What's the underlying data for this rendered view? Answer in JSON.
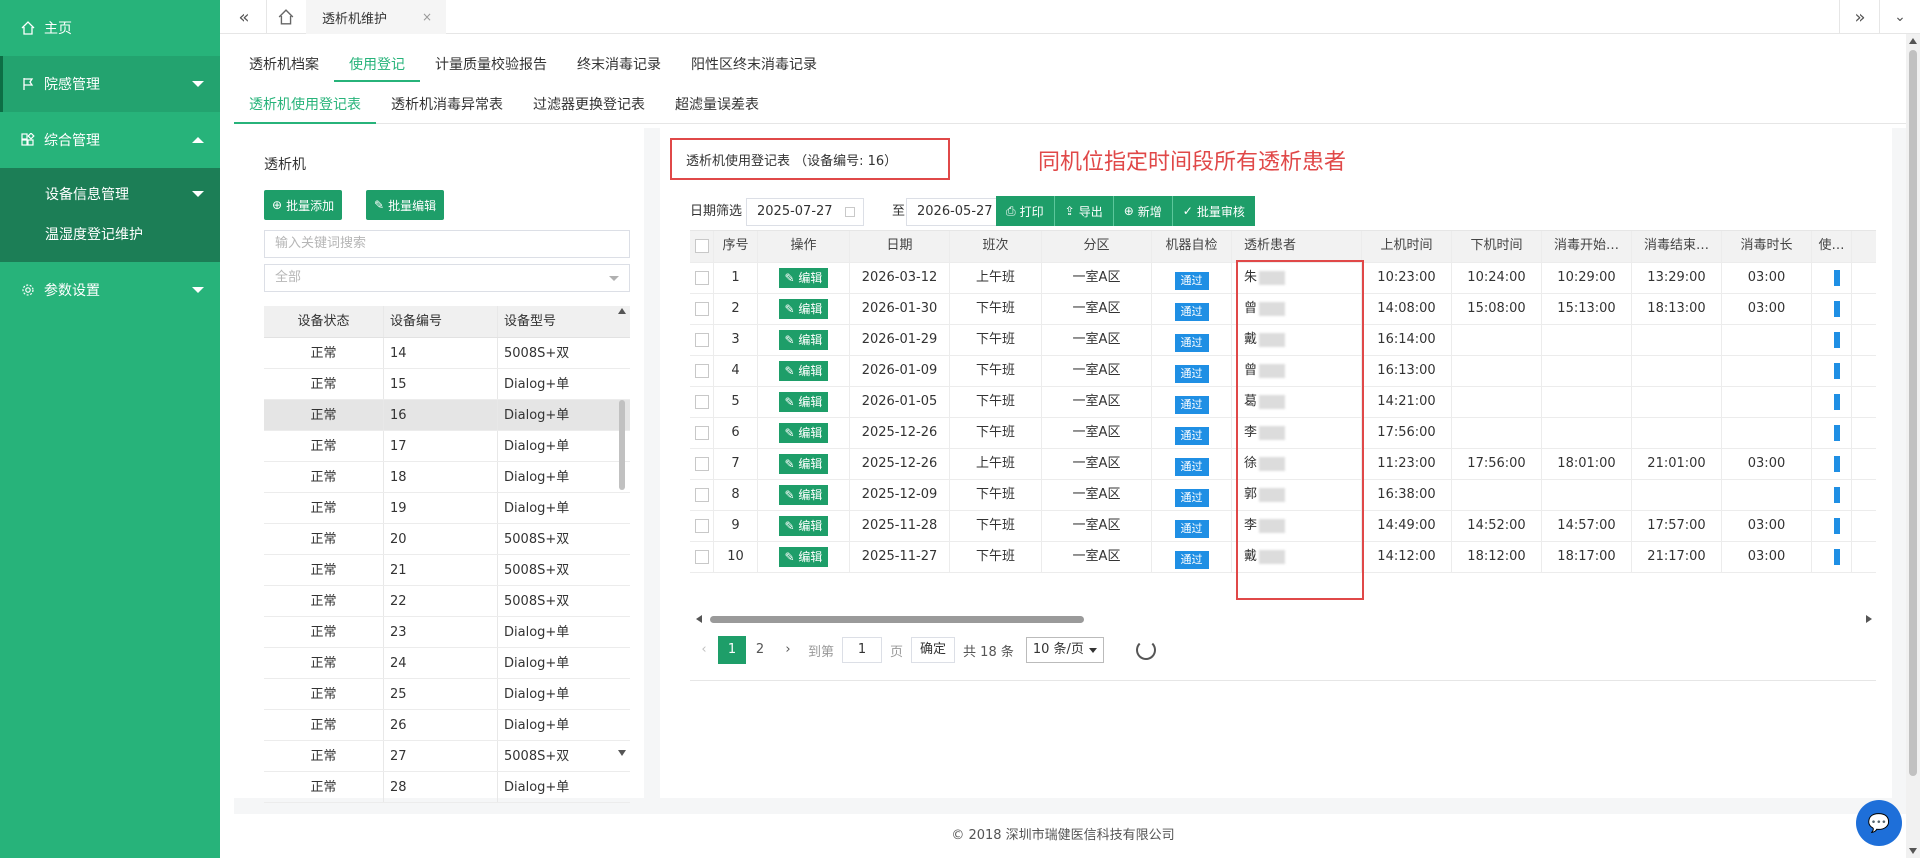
{
  "colors": {
    "sidebar": "#27b37a",
    "accent": "#1e9e69",
    "annotation": "#e04848",
    "badge": "#1f8fe4"
  },
  "sidebar": {
    "items": [
      {
        "label": "主页",
        "icon": "home-icon"
      },
      {
        "label": "院感管理",
        "icon": "flag-icon"
      },
      {
        "label": "综合管理",
        "icon": "apps-icon"
      },
      {
        "label": "参数设置",
        "icon": "gear-icon"
      }
    ],
    "sub_items": [
      {
        "label": "设备信息管理"
      },
      {
        "label": "温湿度登记维护"
      }
    ]
  },
  "topbar": {
    "current_tab": "透析机维护"
  },
  "tabs1": [
    "透析机档案",
    "使用登记",
    "计量质量校验报告",
    "终末消毒记录",
    "阳性区终末消毒记录"
  ],
  "tabs2": [
    "透析机使用登记表",
    "透析机消毒异常表",
    "过滤器更换登记表",
    "超滤量误差表"
  ],
  "left": {
    "title": "透析机",
    "batch_add": "批量添加",
    "batch_edit": "批量编辑",
    "search_placeholder": "输入关键词搜索",
    "filter_value": "全部",
    "headers": [
      "设备状态",
      "设备编号",
      "设备型号"
    ],
    "rows": [
      [
        "正常",
        "14",
        "5008S+双"
      ],
      [
        "正常",
        "15",
        "Dialog+单"
      ],
      [
        "正常",
        "16",
        "Dialog+单"
      ],
      [
        "正常",
        "17",
        "Dialog+单"
      ],
      [
        "正常",
        "18",
        "Dialog+单"
      ],
      [
        "正常",
        "19",
        "Dialog+单"
      ],
      [
        "正常",
        "20",
        "5008S+双"
      ],
      [
        "正常",
        "21",
        "5008S+双"
      ],
      [
        "正常",
        "22",
        "5008S+双"
      ],
      [
        "正常",
        "23",
        "Dialog+单"
      ],
      [
        "正常",
        "24",
        "Dialog+单"
      ],
      [
        "正常",
        "25",
        "Dialog+单"
      ],
      [
        "正常",
        "26",
        "Dialog+单"
      ],
      [
        "正常",
        "27",
        "5008S+双"
      ],
      [
        "正常",
        "28",
        "Dialog+单"
      ]
    ]
  },
  "right": {
    "title": "透析机使用登记表 （设备编号: 16）",
    "annotation": "同机位指定时间段所有透析患者",
    "date_label": "日期筛选",
    "date_from": "2025-07-27",
    "to_label": "至",
    "date_to": "2026-05-27",
    "buttons": [
      {
        "label": "打印",
        "icon": "print-icon"
      },
      {
        "label": "导出",
        "icon": "export-icon"
      },
      {
        "label": "新增",
        "icon": "plus-icon"
      },
      {
        "label": "批量审核",
        "icon": "check-icon"
      }
    ],
    "headers": [
      "序号",
      "操作",
      "日期",
      "班次",
      "分区",
      "机器自检",
      "透析患者",
      "上机时间",
      "下机时间",
      "消毒开始…",
      "消毒结束…",
      "消毒时长",
      "使…"
    ],
    "edit_label": "编辑",
    "pass_label": "通过",
    "rows": [
      {
        "no": "1",
        "date": "2026-03-12",
        "shift": "上午班",
        "area": "一室A区",
        "patient": "朱",
        "on": "10:23:00",
        "off": "10:24:00",
        "ds": "10:29:00",
        "de": "13:29:00",
        "dl": "03:00"
      },
      {
        "no": "2",
        "date": "2026-01-30",
        "shift": "下午班",
        "area": "一室A区",
        "patient": "曾",
        "on": "14:08:00",
        "off": "15:08:00",
        "ds": "15:13:00",
        "de": "18:13:00",
        "dl": "03:00"
      },
      {
        "no": "3",
        "date": "2026-01-29",
        "shift": "下午班",
        "area": "一室A区",
        "patient": "戴",
        "on": "16:14:00",
        "off": "",
        "ds": "",
        "de": "",
        "dl": ""
      },
      {
        "no": "4",
        "date": "2026-01-09",
        "shift": "下午班",
        "area": "一室A区",
        "patient": "曾",
        "on": "16:13:00",
        "off": "",
        "ds": "",
        "de": "",
        "dl": ""
      },
      {
        "no": "5",
        "date": "2026-01-05",
        "shift": "下午班",
        "area": "一室A区",
        "patient": "葛",
        "on": "14:21:00",
        "off": "",
        "ds": "",
        "de": "",
        "dl": ""
      },
      {
        "no": "6",
        "date": "2025-12-26",
        "shift": "下午班",
        "area": "一室A区",
        "patient": "李",
        "on": "17:56:00",
        "off": "",
        "ds": "",
        "de": "",
        "dl": ""
      },
      {
        "no": "7",
        "date": "2025-12-26",
        "shift": "上午班",
        "area": "一室A区",
        "patient": "徐",
        "on": "11:23:00",
        "off": "17:56:00",
        "ds": "18:01:00",
        "de": "21:01:00",
        "dl": "03:00"
      },
      {
        "no": "8",
        "date": "2025-12-09",
        "shift": "下午班",
        "area": "一室A区",
        "patient": "郭",
        "on": "16:38:00",
        "off": "",
        "ds": "",
        "de": "",
        "dl": ""
      },
      {
        "no": "9",
        "date": "2025-11-28",
        "shift": "下午班",
        "area": "一室A区",
        "patient": "李",
        "on": "14:49:00",
        "off": "14:52:00",
        "ds": "14:57:00",
        "de": "17:57:00",
        "dl": "03:00"
      },
      {
        "no": "10",
        "date": "2025-11-27",
        "shift": "下午班",
        "area": "一室A区",
        "patient": "戴",
        "on": "14:12:00",
        "off": "18:12:00",
        "ds": "18:17:00",
        "de": "21:17:00",
        "dl": "03:00"
      }
    ],
    "pager": {
      "page1": "1",
      "page2": "2",
      "goto_label": "到第",
      "goto_value": "1",
      "page_unit": "页",
      "confirm": "确定",
      "total": "共 18 条",
      "size": "10 条/页"
    }
  },
  "footer": "© 2018 深圳市瑞健医信科技有限公司"
}
